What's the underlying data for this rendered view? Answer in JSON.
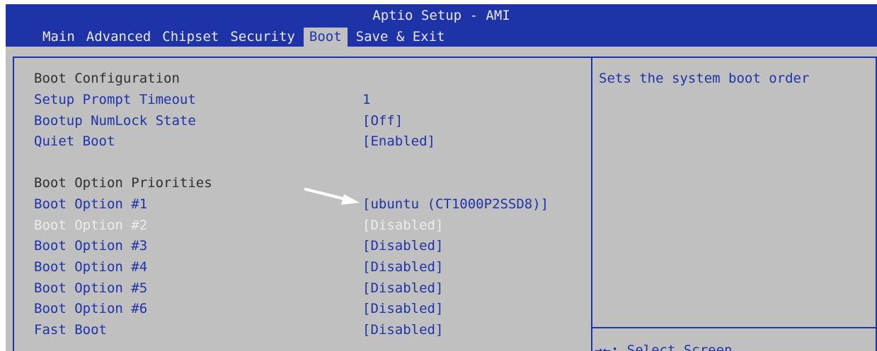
{
  "app": {
    "title": "Aptio Setup - AMI"
  },
  "tabs": [
    {
      "label": "Main",
      "active": false
    },
    {
      "label": "Advanced",
      "active": false
    },
    {
      "label": "Chipset",
      "active": false
    },
    {
      "label": "Security",
      "active": false
    },
    {
      "label": "Boot",
      "active": true
    },
    {
      "label": "Save & Exit",
      "active": false
    }
  ],
  "settings": {
    "boot_configuration": "Boot Configuration",
    "setup_prompt_timeout": {
      "label": "Setup Prompt Timeout",
      "value": "1"
    },
    "bootup_numlock_state": {
      "label": "Bootup NumLock State",
      "value": "[Off]"
    },
    "quiet_boot": {
      "label": "Quiet Boot",
      "value": "[Enabled]"
    },
    "boot_option_priorities": "Boot Option Priorities",
    "boot_options": [
      {
        "label": "Boot Option #1",
        "value": "[ubuntu (CT1000P2SSD8)]"
      },
      {
        "label": "Boot Option #2",
        "value": "[Disabled]"
      },
      {
        "label": "Boot Option #3",
        "value": "[Disabled]"
      },
      {
        "label": "Boot Option #4",
        "value": "[Disabled]"
      },
      {
        "label": "Boot Option #5",
        "value": "[Disabled]"
      },
      {
        "label": "Boot Option #6",
        "value": "[Disabled]"
      }
    ],
    "fast_boot": {
      "label": "Fast Boot",
      "value": "[Disabled]"
    }
  },
  "help": {
    "text": "Sets the system boot order",
    "keys_arrows": "→←:",
    "keys_label": " Select Screen"
  },
  "colors": {
    "bar": "#1f33a8",
    "background": "#c0c0c0",
    "text_item": "#1f33a8",
    "text_header": "#303030",
    "text_disabled": "#ececec",
    "annotation_arrow": "#ffffff"
  }
}
